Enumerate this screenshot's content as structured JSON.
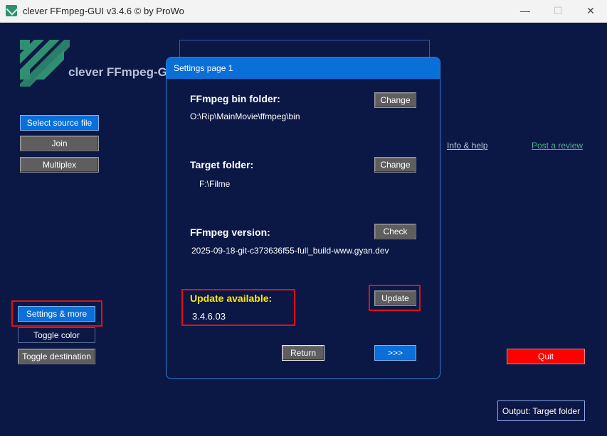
{
  "window": {
    "title": "clever FFmpeg-GUI v3.4.6   © by ProWo",
    "minimize": "—",
    "maximize": "☐",
    "close": "✕"
  },
  "branding": {
    "logo_text": "clever FFmpeg-GUI"
  },
  "left_panel": {
    "select_source": "Select source file",
    "join": "Join",
    "multiplex": "Multiplex",
    "settings_more": "Settings & more",
    "toggle_color": "Toggle color",
    "toggle_destination": "Toggle destination"
  },
  "links": {
    "info_help": "Info & help",
    "post_review": "Post a review"
  },
  "dialog": {
    "title": "Settings page 1",
    "ffmpeg_bin_label": "FFmpeg bin folder:",
    "ffmpeg_bin_value": "O:\\Rip\\MainMovie\\ffmpeg\\bin",
    "change_label": "Change",
    "target_label": "Target folder:",
    "target_value": "F:\\Filme",
    "version_label": "FFmpeg version:",
    "version_value": "2025-09-18-git-c373636f55-full_build-www.gyan.dev",
    "check_label": "Check",
    "update_available_label": "Update available:",
    "update_version": "3.4.6.03",
    "update_button": "Update",
    "return_button": "Return",
    "next_button": ">>>"
  },
  "quit": "Quit",
  "output": "Output: Target folder",
  "colors": {
    "accent": "#0a6fd8",
    "background": "#0b1845",
    "warning": "#ffe800",
    "highlight": "#e0101a"
  }
}
